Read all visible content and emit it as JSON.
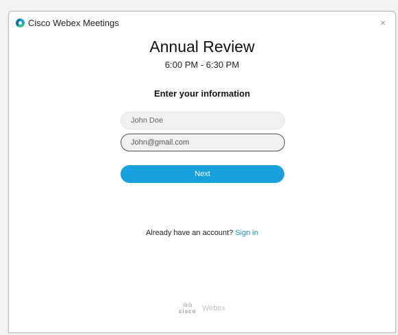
{
  "window": {
    "app_title": "Cisco Webex Meetings",
    "close_glyph": "×"
  },
  "meeting": {
    "title": "Annual Review",
    "time": "6:00 PM - 6:30 PM"
  },
  "form": {
    "heading": "Enter your information",
    "name_placeholder": "John Doe",
    "email_value": "John@gmail.com",
    "next_label": "Next"
  },
  "footer": {
    "account_prompt": "Already have an account?",
    "sign_in_label": "Sign in"
  },
  "branding": {
    "cisco_word": "cisco",
    "webex_word": "Webex"
  },
  "colors": {
    "accent": "#16a0dc",
    "link": "#1a8fd6"
  },
  "icons": {
    "app_logo": "webex-logo-icon",
    "close": "close-icon",
    "cisco_bars": "cisco-bars-icon"
  }
}
